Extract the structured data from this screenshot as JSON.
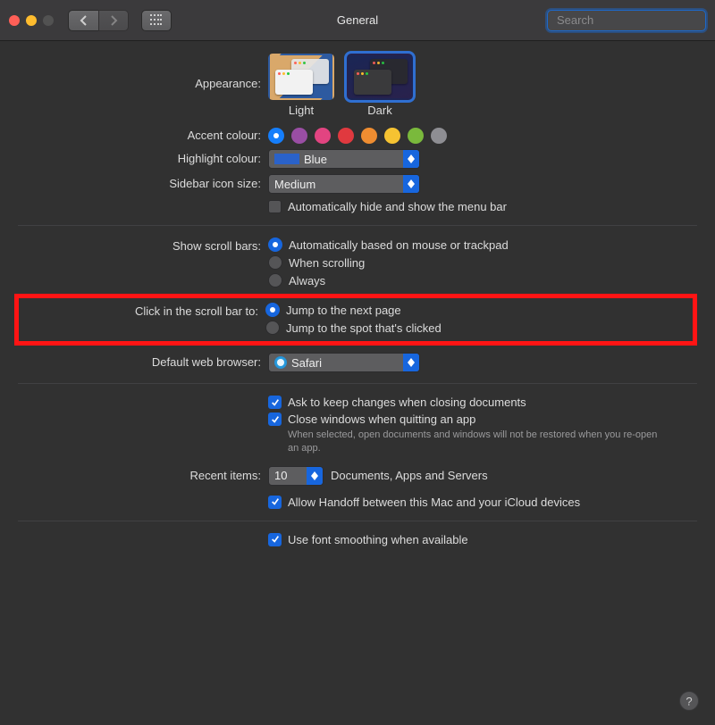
{
  "window": {
    "title": "General"
  },
  "search": {
    "placeholder": "Search"
  },
  "appearance": {
    "label": "Appearance:",
    "options": {
      "light": "Light",
      "dark": "Dark"
    },
    "selected": "dark"
  },
  "accent": {
    "label": "Accent colour:",
    "colors": [
      "#157efb",
      "#9a4ea4",
      "#e24481",
      "#e0393f",
      "#ef8d31",
      "#f6c332",
      "#7ab93c",
      "#8e8e93"
    ],
    "selected_index": 0
  },
  "highlight": {
    "label": "Highlight colour:",
    "value": "Blue"
  },
  "sidebar_size": {
    "label": "Sidebar icon size:",
    "value": "Medium"
  },
  "menubar_autohide": {
    "label": "Automatically hide and show the menu bar",
    "checked": false
  },
  "scrollbars": {
    "label": "Show scroll bars:",
    "options": [
      "Automatically based on mouse or trackpad",
      "When scrolling",
      "Always"
    ],
    "selected_index": 0
  },
  "scroll_click": {
    "label": "Click in the scroll bar to:",
    "options": [
      "Jump to the next page",
      "Jump to the spot that's clicked"
    ],
    "selected_index": 0
  },
  "browser": {
    "label": "Default web browser:",
    "value": "Safari"
  },
  "ask_keep": {
    "label": "Ask to keep changes when closing documents",
    "checked": true
  },
  "close_windows": {
    "label": "Close windows when quitting an app",
    "checked": true,
    "hint": "When selected, open documents and windows will not be restored when you re-open an app."
  },
  "recent": {
    "label": "Recent items:",
    "value": "10",
    "suffix": "Documents, Apps and Servers"
  },
  "handoff": {
    "label": "Allow Handoff between this Mac and your iCloud devices",
    "checked": true
  },
  "font_smoothing": {
    "label": "Use font smoothing when available",
    "checked": true
  }
}
